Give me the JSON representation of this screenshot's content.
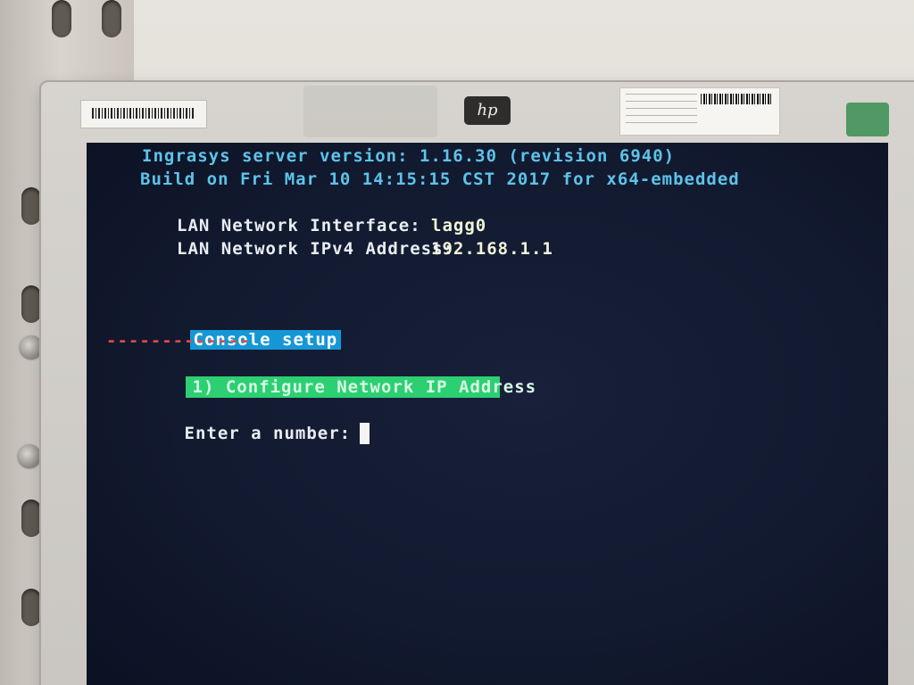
{
  "terminal": {
    "header": {
      "version_line": "Ingrasys server version: 1.16.30 (revision 6940)",
      "build_line": "Build on Fri Mar 10 14:15:15 CST 2017 for x64-embedded"
    },
    "network": {
      "interface_label": "LAN Network Interface:",
      "interface_value": "lagg0",
      "ipv4_label": "LAN Network IPv4 Address:",
      "ipv4_value": "192.168.1.1"
    },
    "menu": {
      "title": "Console setup",
      "divider": "-------------",
      "items": [
        {
          "label": "1) Configure Network IP Address"
        }
      ]
    },
    "prompt": {
      "label": "Enter a number:",
      "value": ""
    }
  },
  "monitor": {
    "brand_logo": "hp"
  },
  "colors": {
    "screen_bg": "#121a30",
    "text_cyan": "#5dc3e9",
    "text_white": "#e9eef2",
    "menu_title_bg": "#1597d6",
    "menu_item_bg": "#2ccf72",
    "divider": "#e24a44"
  }
}
